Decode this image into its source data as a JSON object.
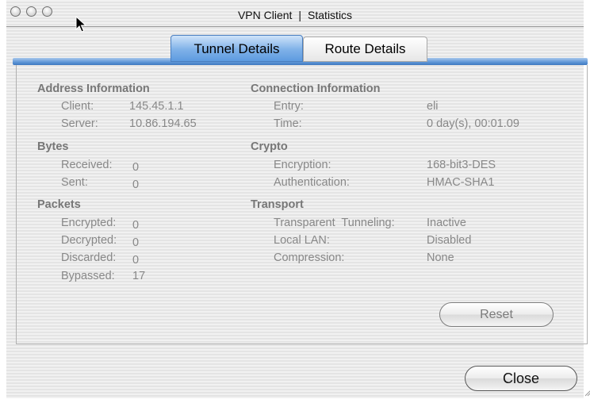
{
  "window": {
    "title_app": "VPN Client",
    "title_sep": "|",
    "title_section": "Statistics"
  },
  "tabs": [
    {
      "label": "Tunnel Details",
      "selected": true
    },
    {
      "label": "Route Details",
      "selected": false
    }
  ],
  "address": {
    "heading": "Address Information",
    "client_label": "Client:",
    "client_value": "145.45.1.1",
    "server_label": "Server:",
    "server_value": "10.86.194.65"
  },
  "bytes": {
    "heading": "Bytes",
    "received_label": "Received:",
    "received_value": "0",
    "sent_label": "Sent:",
    "sent_value": "0"
  },
  "packets": {
    "heading": "Packets",
    "encrypted_label": "Encrypted:",
    "encrypted_value": "0",
    "decrypted_label": "Decrypted:",
    "decrypted_value": "0",
    "discarded_label": "Discarded:",
    "discarded_value": "0",
    "bypassed_label": "Bypassed:",
    "bypassed_value": "17"
  },
  "connection": {
    "heading": "Connection Information",
    "entry_label": "Entry:",
    "entry_value": "eli",
    "time_label": "Time:",
    "time_value": "0 day(s), 00:01.09"
  },
  "crypto": {
    "heading": "Crypto",
    "encryption_label": "Encryption:",
    "encryption_value": "168-bit3-DES",
    "auth_label": "Authentication:",
    "auth_value": "HMAC-SHA1"
  },
  "transport": {
    "heading": "Transport",
    "tunneling_label": "Transparent  Tunneling:",
    "tunneling_value": "Inactive",
    "lan_label": "Local LAN:",
    "lan_value": "Disabled",
    "compression_label": "Compression:",
    "compression_value": "None"
  },
  "buttons": {
    "reset": "Reset",
    "close": "Close"
  }
}
